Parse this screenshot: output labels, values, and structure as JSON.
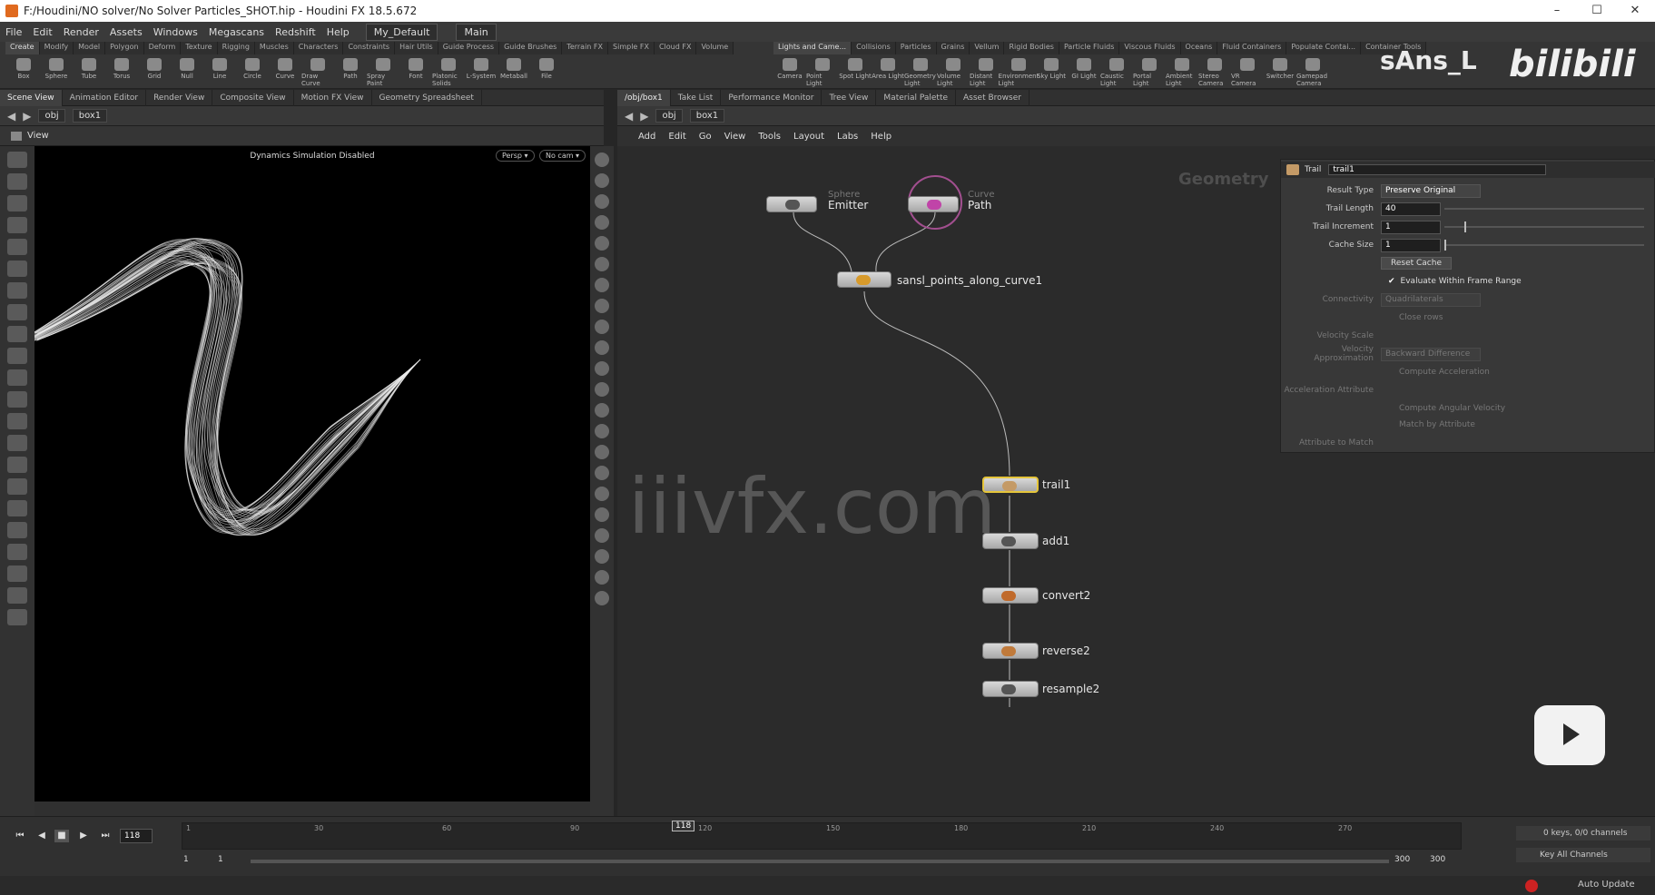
{
  "window": {
    "title": "F:/Houdini/NO solver/No Solver Particles_SHOT.hip - Houdini FX 18.5.672",
    "minimize": "–",
    "maximize": "☐",
    "close": "✕"
  },
  "menubar": {
    "items": [
      "File",
      "Edit",
      "Render",
      "Assets",
      "Windows",
      "Megascans",
      "Redshift",
      "Help"
    ],
    "desktop": "My_Default",
    "context": "Main"
  },
  "shelf_left": {
    "tabs": [
      "Create",
      "Modify",
      "Model",
      "Polygon",
      "Deform",
      "Texture",
      "Rigging",
      "Muscles",
      "Characters",
      "Constraints",
      "Hair Utils",
      "Guide Process",
      "Guide Brushes",
      "Terrain FX",
      "Simple FX",
      "Cloud FX",
      "Volume"
    ],
    "tools": [
      "Box",
      "Sphere",
      "Tube",
      "Torus",
      "Grid",
      "Null",
      "Line",
      "Circle",
      "Curve",
      "Draw Curve",
      "Path",
      "Spray Paint",
      "Font",
      "Platonic Solids",
      "L-System",
      "Metaball",
      "File"
    ]
  },
  "shelf_right": {
    "tabs": [
      "Lights and Came...",
      "Collisions",
      "Particles",
      "Grains",
      "Vellum",
      "Rigid Bodies",
      "Particle Fluids",
      "Viscous Fluids",
      "Oceans",
      "Fluid Containers",
      "Populate Contai...",
      "Container Tools"
    ],
    "tools": [
      "Camera",
      "Point Light",
      "Spot Light",
      "Area Light",
      "Geometry Light",
      "Volume Light",
      "Distant Light",
      "Environment Light",
      "Sky Light",
      "GI Light",
      "Caustic Light",
      "Portal Light",
      "Ambient Light",
      "Stereo Camera",
      "VR Camera",
      "Switcher",
      "Gamepad Camera"
    ]
  },
  "overlay": {
    "sans": "sAns_L",
    "bili": "bilibili",
    "watermark": "iiivfx.com",
    "main": "Main"
  },
  "left_pane": {
    "tabs": [
      "Scene View",
      "Animation Editor",
      "Render View",
      "Composite View",
      "Motion FX View",
      "Geometry Spreadsheet"
    ],
    "path_obj": "obj",
    "path_box": "box1",
    "view_label": "View",
    "status": "Dynamics Simulation Disabled",
    "persp": "Persp ▾",
    "cam": "No cam ▾"
  },
  "right_pane": {
    "tabs": [
      "/obj/box1",
      "Take List",
      "Performance Monitor",
      "Tree View",
      "Material Palette",
      "Asset Browser"
    ],
    "path_obj": "obj",
    "path_box": "box1",
    "menu": [
      "Add",
      "Edit",
      "Go",
      "View",
      "Tools",
      "Layout",
      "Labs",
      "Help"
    ],
    "context_label": "Geometry"
  },
  "params": {
    "node_type": "Trail",
    "node_name": "trail1",
    "result_type_label": "Result Type",
    "result_type": "Preserve Original",
    "trail_length_label": "Trail Length",
    "trail_length": "40",
    "trail_increment_label": "Trail Increment",
    "trail_increment": "1",
    "cache_size_label": "Cache Size",
    "cache_size": "1",
    "reset_cache": "Reset Cache",
    "evaluate_label": "Evaluate Within Frame Range",
    "connectivity_label": "Connectivity",
    "connectivity": "Quadrilaterals",
    "close_rows": "Close rows",
    "velocity_scale_label": "Velocity Scale",
    "velocity_approx_label": "Velocity Approximation",
    "velocity_approx": "Backward Difference",
    "compute_accel": "Compute Acceleration",
    "accel_attr_label": "Acceleration Attribute",
    "compute_ang_vel": "Compute Angular Velocity",
    "match_attr": "Match by Attribute",
    "attr_match_label": "Attribute to Match"
  },
  "nodes": {
    "sphere_type": "Sphere",
    "emitter": "Emitter",
    "curve_type": "Curve",
    "path": "Path",
    "sansl": "sansl_points_along_curve1",
    "trail": "trail1",
    "add": "add1",
    "convert": "convert2",
    "reverse": "reverse2",
    "resample": "resample2"
  },
  "timeline": {
    "frame": "118",
    "playhead": "118",
    "ticks": [
      "1",
      "30",
      "60",
      "90",
      "120",
      "150",
      "180",
      "210",
      "240",
      "270"
    ],
    "range_start": "1",
    "range_start2": "1",
    "range_end": "300",
    "range_end2": "300",
    "keys": "0 keys, 0/0 channels",
    "key_all": "Key All Channels",
    "auto_update": "Auto Update"
  },
  "colors": {
    "accent": "#e5c53a",
    "viewport_bg": "#000000",
    "panel": "#383838"
  }
}
